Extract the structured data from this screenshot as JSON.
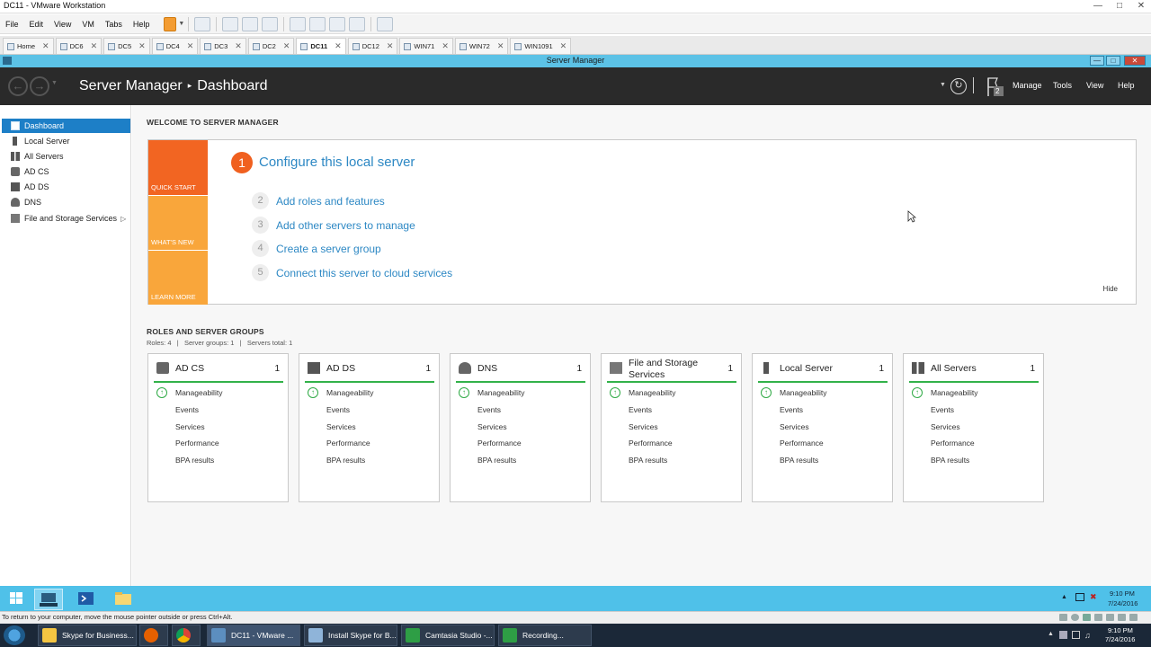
{
  "vmware": {
    "title": "DC11 - VMware Workstation",
    "menu": [
      "File",
      "Edit",
      "View",
      "VM",
      "Tabs",
      "Help"
    ],
    "tabs": [
      {
        "label": "Home",
        "active": false
      },
      {
        "label": "DC6",
        "active": false
      },
      {
        "label": "DC5",
        "active": false
      },
      {
        "label": "DC4",
        "active": false
      },
      {
        "label": "DC3",
        "active": false
      },
      {
        "label": "DC2",
        "active": false
      },
      {
        "label": "DC11",
        "active": true
      },
      {
        "label": "DC12",
        "active": false
      },
      {
        "label": "WIN71",
        "active": false
      },
      {
        "label": "WIN72",
        "active": false
      },
      {
        "label": "WIN1091",
        "active": false
      }
    ],
    "status_text": "To return to your computer, move the mouse pointer outside or press Ctrl+Alt."
  },
  "server_manager": {
    "window_title": "Server Manager",
    "breadcrumb_root": "Server Manager",
    "breadcrumb_sep": "▸",
    "breadcrumb_page": "Dashboard",
    "notification_count": "2",
    "header_menu": [
      "Manage",
      "Tools",
      "View",
      "Help"
    ]
  },
  "sidebar": {
    "items": [
      {
        "label": "Dashboard",
        "icon": "dashboard-icon",
        "active": true
      },
      {
        "label": "Local Server",
        "icon": "server-icon"
      },
      {
        "label": "All Servers",
        "icon": "servers-icon"
      },
      {
        "label": "AD CS",
        "icon": "adcs-icon"
      },
      {
        "label": "AD DS",
        "icon": "adds-icon"
      },
      {
        "label": "DNS",
        "icon": "dns-icon"
      },
      {
        "label": "File and Storage Services",
        "icon": "storage-icon",
        "expand": "▷"
      }
    ]
  },
  "welcome": {
    "heading": "WELCOME TO SERVER MANAGER",
    "quick_start": "QUICK START",
    "whats_new": "WHAT'S NEW",
    "learn_more": "LEARN MORE",
    "main_step_num": "1",
    "main_step": "Configure this local server",
    "steps": [
      {
        "num": "2",
        "label": "Add roles and features"
      },
      {
        "num": "3",
        "label": "Add other servers to manage"
      },
      {
        "num": "4",
        "label": "Create a server group"
      },
      {
        "num": "5",
        "label": "Connect this server to cloud services"
      }
    ],
    "hide": "Hide",
    "colors": {
      "quick_start": "#f26522",
      "whats_new": "#f9a63b",
      "learn_more": "#f9a63b"
    }
  },
  "roles": {
    "heading": "ROLES AND SERVER GROUPS",
    "summary": "Roles: 4   |   Server groups: 1   |   Servers total: 1",
    "tiles": [
      {
        "title": "AD CS",
        "count": "1",
        "icon": "adcs-icon"
      },
      {
        "title": "AD DS",
        "count": "1",
        "icon": "adds-icon"
      },
      {
        "title": "DNS",
        "count": "1",
        "icon": "dns-icon"
      },
      {
        "title": "File and Storage Services",
        "count": "1",
        "icon": "storage-icon"
      },
      {
        "title": "Local Server",
        "count": "1",
        "icon": "server-icon"
      },
      {
        "title": "All Servers",
        "count": "1",
        "icon": "servers-icon"
      }
    ],
    "tile_rows": [
      "Manageability",
      "Events",
      "Services",
      "Performance",
      "BPA results"
    ],
    "status_color": "#32b24a"
  },
  "guest_taskbar": {
    "time": "9:10 PM",
    "date": "7/24/2016"
  },
  "host_taskbar": {
    "apps": [
      {
        "label": "Skype for Business...",
        "color": "#f4c542"
      },
      {
        "label": "",
        "color": "#e66000"
      },
      {
        "label": "",
        "color": "#3aa757"
      },
      {
        "label": "DC11 - VMware ...",
        "color": "#5c8ebf"
      },
      {
        "label": "Install Skype for B...",
        "color": "#8fb4d9"
      },
      {
        "label": "Camtasia Studio -...",
        "color": "#2e9e45"
      },
      {
        "label": "Recording...",
        "color": "#2e9e45"
      }
    ],
    "time": "9:10 PM",
    "date": "7/24/2016"
  }
}
